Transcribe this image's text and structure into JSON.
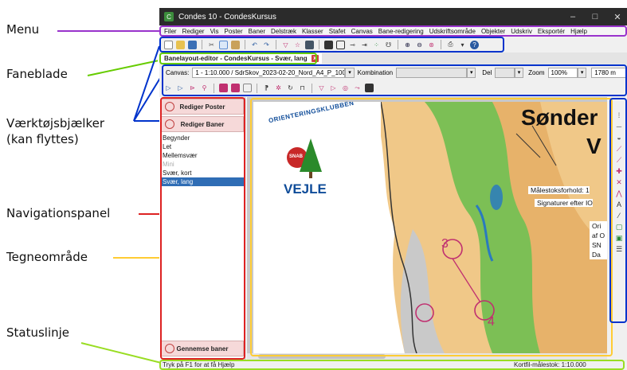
{
  "annotations": {
    "menu": "Menu",
    "tabs": "Faneblade",
    "toolbars_line1": "Værktøjsbjælker",
    "toolbars_line2": "(kan flyttes)",
    "navpanel": "Navigationspanel",
    "drawarea": "Tegneområde",
    "statusline": "Statuslinje"
  },
  "colors": {
    "menu": "#9933cc",
    "tabs": "#66cc00",
    "toolbars": "#0033cc",
    "navpanel": "#dd2222",
    "drawarea": "#ffcc33",
    "statusline": "#99dd22"
  },
  "window": {
    "title": "Condes 10 - CondesKursus",
    "app_icon": "condes-logo-icon",
    "minimize": "–",
    "maximize": "□",
    "close": "✕"
  },
  "menu": {
    "items": [
      "Filer",
      "Rediger",
      "Vis",
      "Poster",
      "Baner",
      "Delstræk",
      "Klasser",
      "Stafet",
      "Canvas",
      "Bane-redigering",
      "Udskriftsområde",
      "Objekter",
      "Udskriv",
      "Eksportér",
      "Hjælp"
    ]
  },
  "tab": {
    "label": "Banelayout-editor - CondesKursus - Svær, lang",
    "close": "x"
  },
  "canvas_toolbar": {
    "canvas_label": "Canvas:",
    "canvas_value": "1 - 1:10.000 / SdrSkov_2023-02-20_Nord_A4_P_10000.o",
    "combination_label": "Kombination",
    "part_label": "Del",
    "zoom_label": "Zoom",
    "zoom_value": "100%",
    "distance_value": "1780 m"
  },
  "navpanel": {
    "edit_controls": "Rediger Poster",
    "edit_courses": "Rediger Baner",
    "courses": [
      {
        "name": "Begynder"
      },
      {
        "name": "Let"
      },
      {
        "name": "Mellemsvær"
      },
      {
        "name": "Mini"
      },
      {
        "name": "Svær, kort"
      },
      {
        "name": "Svær, lang"
      }
    ],
    "review_courses": "Gennemse baner"
  },
  "map": {
    "title_line1": "Sønder",
    "title_line2": "V",
    "scale_text": "Målestoksforhold: 1",
    "symbols_text": "Signaturer efter IO",
    "info_lines": [
      "Ori",
      "af O",
      "SN",
      "Da"
    ],
    "club_arc": "ORIENTERINGSKLUBBEN",
    "club_badge": "SNAB",
    "club_city": "VEJLE",
    "control_numbers": [
      "3",
      "4"
    ]
  },
  "status": {
    "left": "Tryk på F1 for at få Hjælp",
    "right": "Kortfil-målestok: 1:10.000"
  }
}
